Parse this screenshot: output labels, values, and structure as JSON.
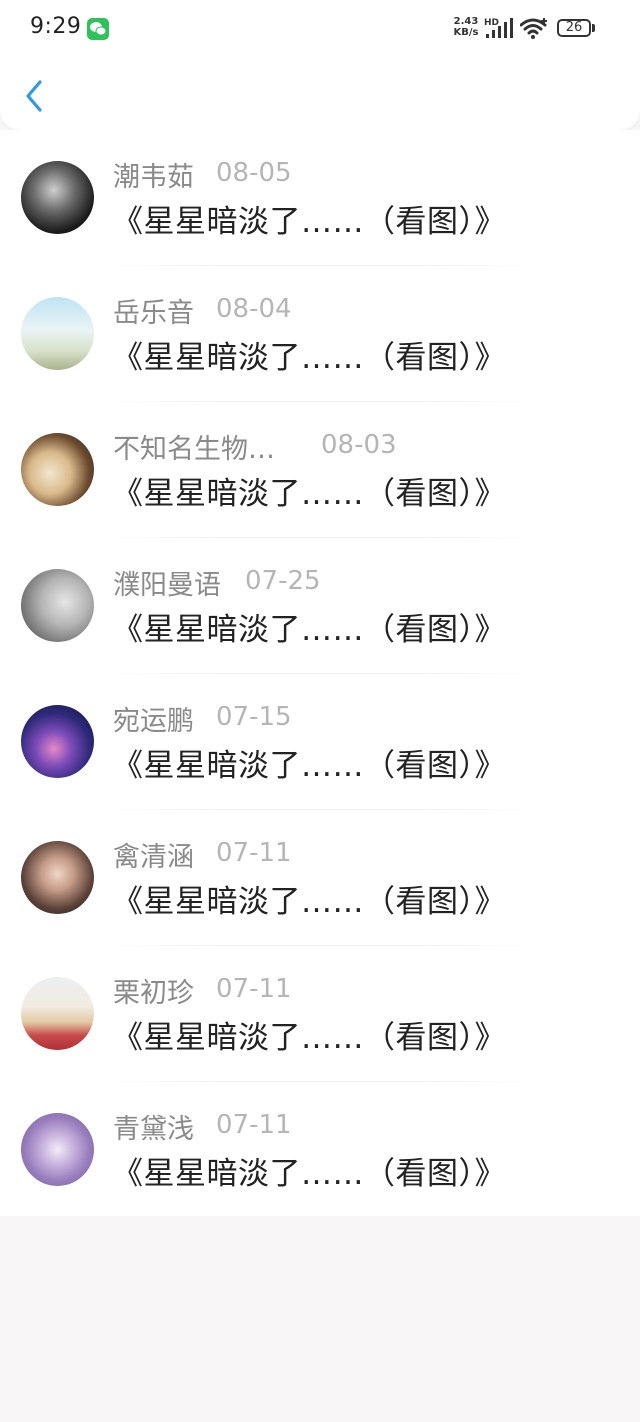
{
  "status_bar": {
    "time": "9:29",
    "net_speed_value": "2.43",
    "net_speed_unit": "KB/s",
    "network_label": "HD",
    "battery": "26",
    "icons": [
      "wechat-icon",
      "signal-icon",
      "wifi-icon",
      "battery-icon"
    ]
  },
  "header": {
    "back_icon": "chevron-left-icon",
    "accent_color": "#2e9ae6"
  },
  "items": [
    {
      "name": "潮韦茹",
      "date": "08-05",
      "title": "《星星暗淡了……（看图）》"
    },
    {
      "name": "岳乐音",
      "date": "08-04",
      "title": "《星星暗淡了……（看图）》"
    },
    {
      "name": "不知名生物…",
      "date": "08-03",
      "title": "《星星暗淡了……（看图）》"
    },
    {
      "name": "濮阳曼语",
      "date": "07-25",
      "title": "《星星暗淡了……（看图）》"
    },
    {
      "name": "宛运鹏",
      "date": "07-15",
      "title": "《星星暗淡了……（看图）》"
    },
    {
      "name": "禽清涵",
      "date": "07-11",
      "title": "《星星暗淡了……（看图）》"
    },
    {
      "name": "栗初珍",
      "date": "07-11",
      "title": "《星星暗淡了……（看图）》"
    },
    {
      "name": "青黛浅",
      "date": "07-11",
      "title": "《星星暗淡了……（看图）》"
    }
  ]
}
